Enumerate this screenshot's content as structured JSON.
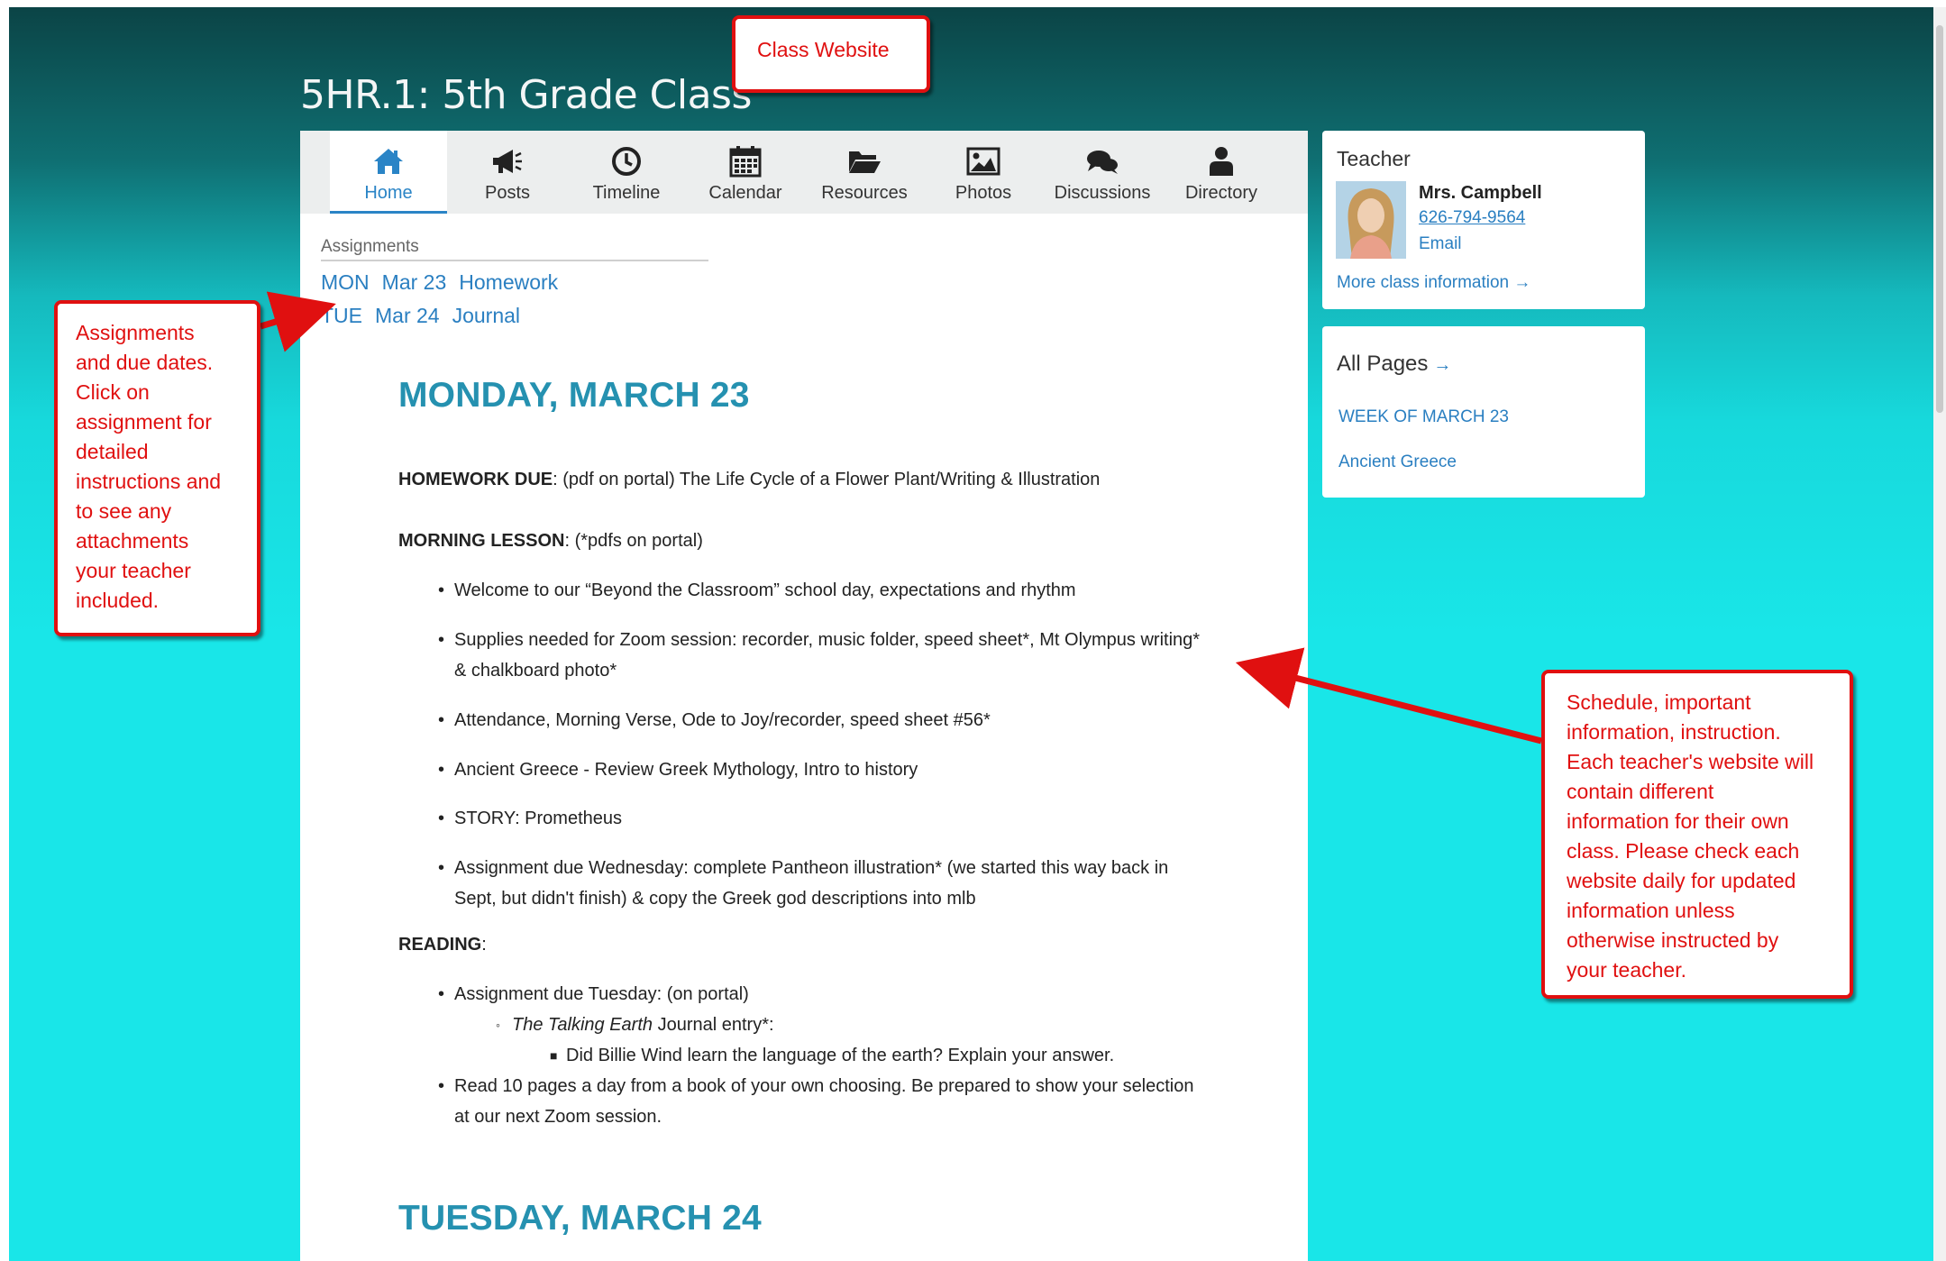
{
  "class_title": "5HR.1: 5th Grade Class",
  "nav": [
    {
      "label": "Home",
      "icon": "home-icon",
      "active": true
    },
    {
      "label": "Posts",
      "icon": "megaphone-icon"
    },
    {
      "label": "Timeline",
      "icon": "clock-icon"
    },
    {
      "label": "Calendar",
      "icon": "calendar-icon"
    },
    {
      "label": "Resources",
      "icon": "folder-icon"
    },
    {
      "label": "Photos",
      "icon": "image-icon"
    },
    {
      "label": "Discussions",
      "icon": "chat-icon"
    },
    {
      "label": "Directory",
      "icon": "person-icon"
    }
  ],
  "assignments": {
    "heading": "Assignments",
    "items": [
      {
        "day": "MON",
        "date": "Mar 23",
        "title": "Homework"
      },
      {
        "day": "TUE",
        "date": "Mar 24",
        "title": "Journal"
      }
    ]
  },
  "content": {
    "day1_heading": "MONDAY, MARCH 23",
    "homework_label": "HOMEWORK DUE",
    "homework_text": ": (pdf on portal) The Life Cycle of a Flower Plant/Writing & Illustration",
    "lesson_label": "MORNING LESSON",
    "lesson_text": ": (*pdfs on portal)",
    "lesson_bullets": [
      "Welcome to our “Beyond the Classroom” school day, expectations and rhythm",
      "Supplies needed for Zoom session: recorder, music folder, speed sheet*, Mt Olympus writing*",
      "& chalkboard photo*",
      "Attendance, Morning Verse, Ode to Joy/recorder, speed sheet #56*",
      "Ancient Greece - Review Greek Mythology, Intro to history",
      "STORY: Prometheus",
      "Assignment due Wednesday: complete Pantheon illustration* (we started this way back in",
      "Sept, but didn't finish) & copy the Greek god descriptions into mlb"
    ],
    "reading_label": "READING",
    "reading_colon": ":",
    "reading_bullet1": "Assignment due Tuesday: (on portal)",
    "reading_sub_italic": "The Talking Earth",
    "reading_sub_rest": " Journal entry*:",
    "reading_subsub": "Did Billie Wind learn the language of the earth? Explain your answer.",
    "reading_bullet2_line1": "Read 10 pages a day from a book of your own choosing. Be prepared to show your selection",
    "reading_bullet2_line2": "at our next Zoom session.",
    "day2_heading": "TUESDAY, MARCH 24"
  },
  "teacher": {
    "label": "Teacher",
    "name": "Mrs. Campbell",
    "phone": "626-794-9564",
    "email": "Email",
    "more": "More class information →"
  },
  "all_pages": {
    "label": "All Pages",
    "arrow": "→",
    "links": [
      "WEEK OF MARCH 23",
      "Ancient Greece"
    ]
  },
  "callouts": {
    "top": "Class Website",
    "left": [
      "Assignments",
      "and due dates.",
      "Click on",
      "assignment for",
      "detailed",
      "instructions and",
      "to see any",
      "attachments",
      "your teacher",
      "included."
    ],
    "right": [
      "Schedule, important",
      "information, instruction.",
      "Each teacher's website will",
      "contain different",
      "information for their own",
      "class. Please check each",
      "website daily for updated",
      "information unless",
      "otherwise instructed by",
      "your teacher."
    ]
  },
  "colors": {
    "accent_blue": "#2a7fc1",
    "heading_teal": "#2591b0",
    "callout_red": "#e01010",
    "bg_top": "#0b4446",
    "bg_bottom": "#19e6e8"
  }
}
